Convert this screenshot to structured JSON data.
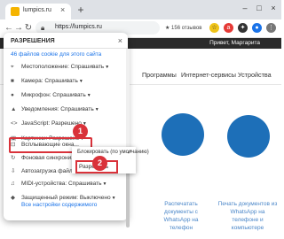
{
  "browser": {
    "tab_title": "lumpics.ru",
    "url": "https://lumpics.ru",
    "reviews": "★ 156 отзывов"
  },
  "site": {
    "greeting": "Привет, Маргарита",
    "tabs": [
      "Программы",
      "Интернет-сервисы",
      "Устройства"
    ],
    "card1_text": [
      "Распечатать",
      "документы с",
      "WhatsApp на",
      "телефон"
    ],
    "card2_text": [
      "Печать документов из",
      "WhatsApp на",
      "телефоне и",
      "компьютере"
    ]
  },
  "popup": {
    "title": "РАЗРЕШЕНИЯ",
    "cookies": "46 файлов cookie для этого сайта",
    "permissions": [
      {
        "icon": "location-icon",
        "glyph": "⌖",
        "label": "Местоположение: Спрашивать"
      },
      {
        "icon": "camera-icon",
        "glyph": "■",
        "label": "Камера: Спрашивать"
      },
      {
        "icon": "mic-icon",
        "glyph": "●",
        "label": "Микрофон: Спрашивать"
      },
      {
        "icon": "bell-icon",
        "glyph": "▲",
        "label": "Уведомления: Спрашивать"
      },
      {
        "icon": "code-icon",
        "glyph": "<>",
        "label": "JavaScript: Разрешено"
      },
      {
        "icon": "image-icon",
        "glyph": "▣",
        "label": "Картинки: Разрешено"
      },
      {
        "icon": "popup-icon",
        "glyph": "⊡",
        "label": "Всплывающие окна..."
      },
      {
        "icon": "sync-icon",
        "glyph": "↻",
        "label": "Фоновая синхронизац..."
      },
      {
        "icon": "download-icon",
        "glyph": "⇩",
        "label": "Автозагрузка файло..."
      },
      {
        "icon": "midi-icon",
        "glyph": "♫",
        "label": "MIDI-устройства: Спрашивать"
      },
      {
        "icon": "shield-icon",
        "glyph": "◆",
        "label": "Защищенный режим: Выключено"
      }
    ],
    "all_settings": "Все настройки содержимого"
  },
  "dropdown": {
    "option_default": "Блокировать (по умолчанию)",
    "option_allow": "Разрешить"
  },
  "badges": {
    "one": "1",
    "two": "2"
  },
  "colors": {
    "accent_red": "#d9323a",
    "link_blue": "#1a73e8"
  }
}
